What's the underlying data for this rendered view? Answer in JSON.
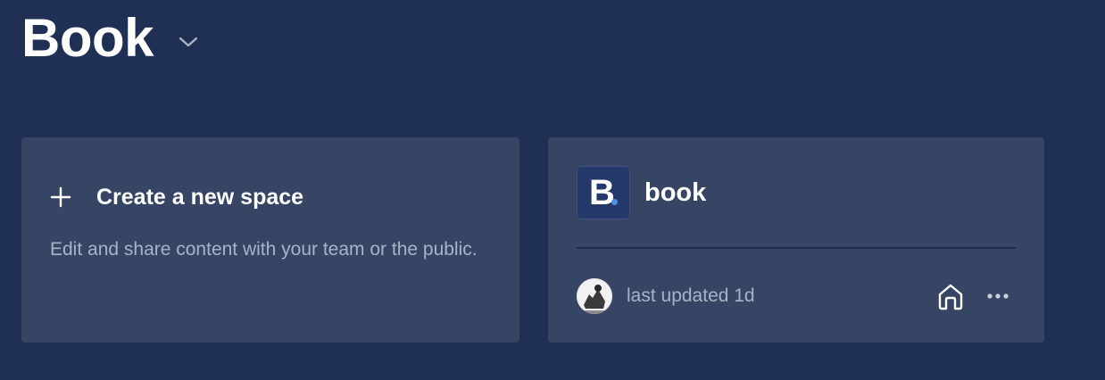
{
  "header": {
    "title": "Book"
  },
  "new_space_card": {
    "title": "Create a new space",
    "description": "Edit and share content with your team or the public."
  },
  "space_card": {
    "logo_letter": "B",
    "name": "book",
    "updated": "last updated 1d"
  },
  "icons": {
    "title_chevron": "chevron-down-icon",
    "plus": "plus-icon",
    "home": "home-icon",
    "more": "more-horizontal-icon"
  },
  "colors": {
    "background": "#1f3054",
    "card": "#354563",
    "muted_text": "#a8b3c7",
    "logo_bg": "#25386a",
    "logo_dot": "#4a90e2"
  }
}
